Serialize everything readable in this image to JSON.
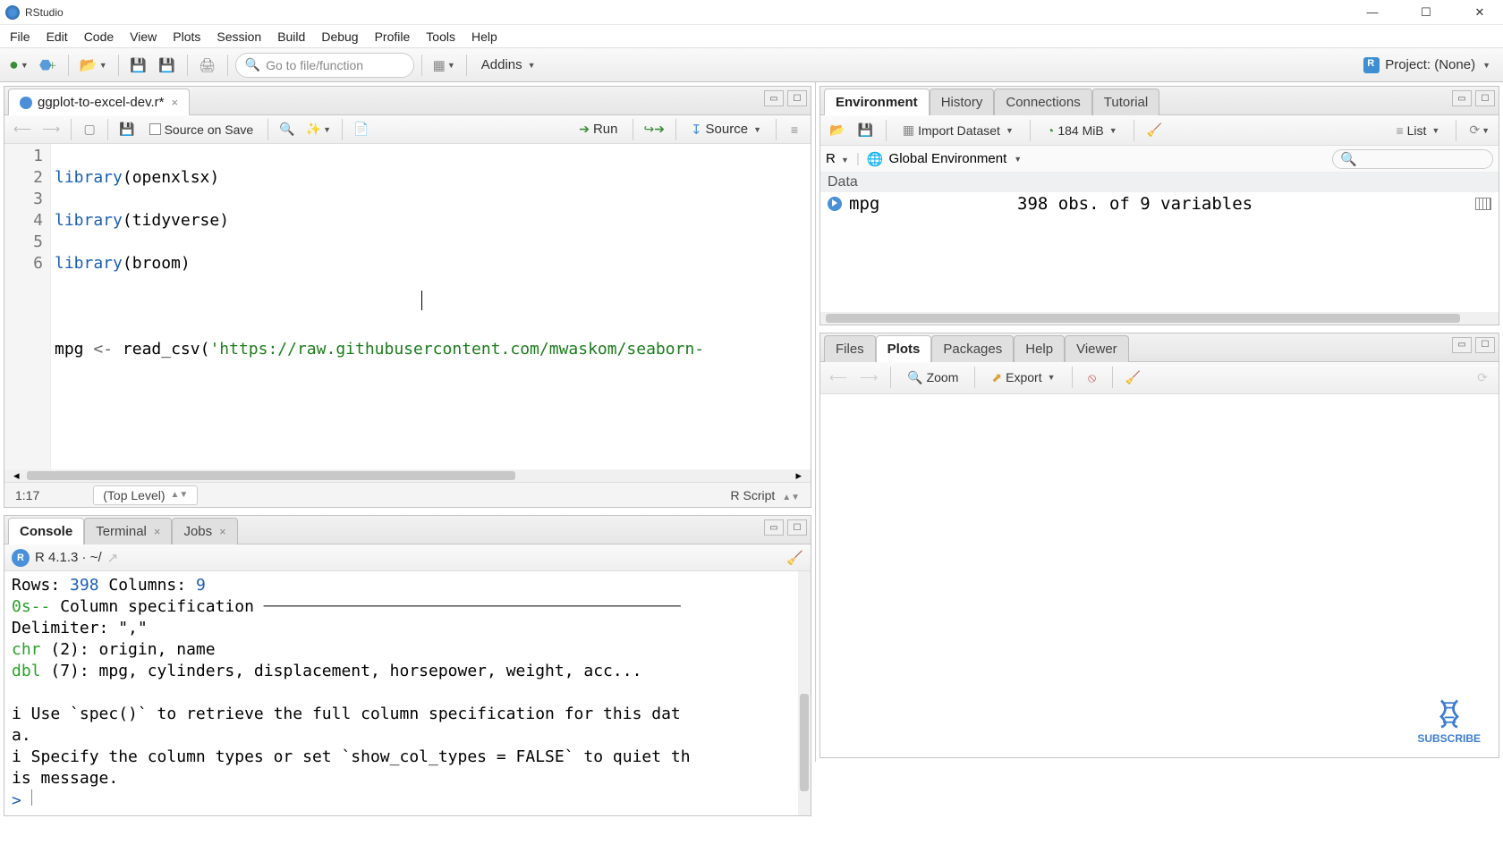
{
  "window": {
    "title": "RStudio"
  },
  "menubar": [
    "File",
    "Edit",
    "Code",
    "View",
    "Plots",
    "Session",
    "Build",
    "Debug",
    "Profile",
    "Tools",
    "Help"
  ],
  "toolbar": {
    "gotofile_placeholder": "Go to file/function",
    "addins_label": "Addins",
    "project_label": "Project: (None)"
  },
  "source": {
    "tab_filename": "ggplot-to-excel-dev.r*",
    "source_on_save": "Source on Save",
    "run_label": "Run",
    "source_label": "Source",
    "lines": {
      "l1_kw": "library",
      "l1_arg": "openxlsx",
      "l2_kw": "library",
      "l2_arg": "tidyverse",
      "l3_kw": "library",
      "l3_arg": "broom",
      "l5_var": "mpg",
      "l5_op": "<-",
      "l5_fn": "read_csv",
      "l5_str": "'https://raw.githubusercontent.com/mwaskom/seaborn-"
    },
    "gutter": [
      "1",
      "2",
      "3",
      "4",
      "5",
      "6"
    ],
    "status_pos": "1:17",
    "status_scope": "(Top Level)",
    "status_lang": "R Script"
  },
  "console": {
    "tabs": [
      "Console",
      "Terminal",
      "Jobs"
    ],
    "context": "R 4.1.3 · ~/",
    "body": {
      "rows": "Rows:",
      "rows_n": "398",
      "cols": "Columns:",
      "cols_n": "9",
      "spec_hdr": "0s-- ",
      "spec_txt": "Column specification",
      "spec_dashes": " ───────────────────────────────────────────",
      "delim": "Delimiter: \",\"",
      "chr": "chr",
      "chr_rest": " (2): origin, name",
      "dbl": "dbl",
      "dbl_rest": " (7): mpg, cylinders, displacement, horsepower, weight, acc...",
      "i1": "i Use `spec()` to retrieve the full column specification for this dat",
      "i1b": "a.",
      "i2": "i Specify the column types or set `show_col_types = FALSE` to quiet th",
      "i2b": "is message.",
      "prompt": ">"
    }
  },
  "environment": {
    "tabs": [
      "Environment",
      "History",
      "Connections",
      "Tutorial"
    ],
    "import_label": "Import Dataset",
    "memory_label": "184 MiB",
    "list_label": "List",
    "lang_label": "R",
    "scope_label": "Global Environment",
    "section": "Data",
    "rows": [
      {
        "name": "mpg",
        "value": "398 obs. of 9 variables"
      }
    ]
  },
  "lowerright": {
    "tabs": [
      "Files",
      "Plots",
      "Packages",
      "Help",
      "Viewer"
    ],
    "zoom_label": "Zoom",
    "export_label": "Export",
    "subscribe": "SUBSCRIBE"
  }
}
